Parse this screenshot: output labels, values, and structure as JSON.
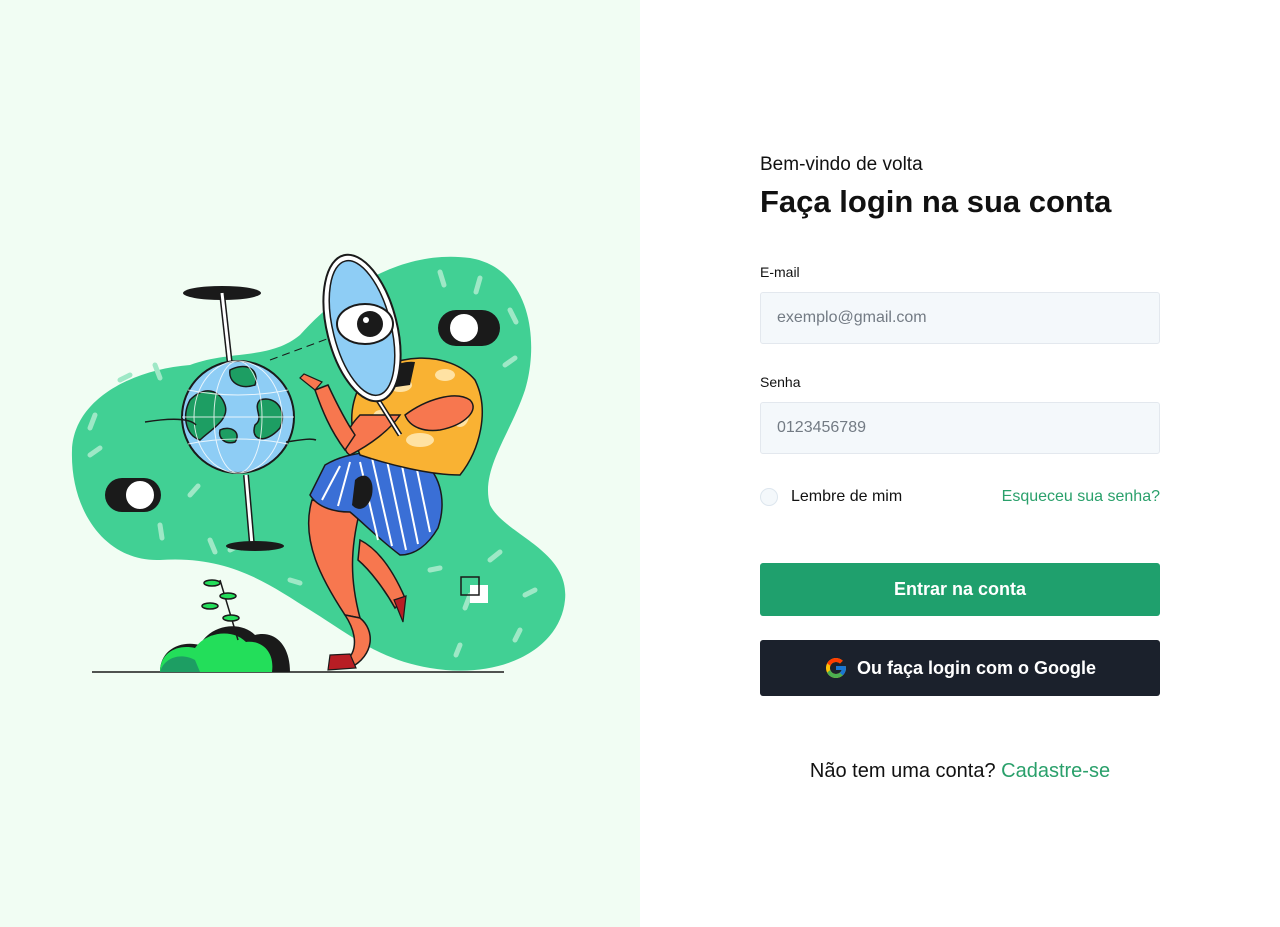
{
  "illustration": {
    "icon": "person-with-magnifier-and-globe-illustration",
    "colors": {
      "panel_bg": "#f1fdf3",
      "blob": "#41d094",
      "shirt": "#f9b233",
      "skin": "#f7774f",
      "shorts": "#3a6fd6"
    }
  },
  "form": {
    "welcome": "Bem-vindo de volta",
    "title": "Faça login na sua conta",
    "email": {
      "label": "E-mail",
      "placeholder": "exemplo@gmail.com",
      "value": ""
    },
    "password": {
      "label": "Senha",
      "placeholder": "0123456789",
      "value": ""
    },
    "remember_label": "Lembre de mim",
    "forgot_link": "Esqueceu sua senha?",
    "login_button": "Entrar na conta",
    "google_button": "Ou faça login com o Google",
    "google_icon": "google-icon",
    "signup_prompt": "Não tem uma conta?",
    "signup_link": "Cadastre-se"
  },
  "colors": {
    "accent": "#1fa06d",
    "link": "#2aa06b",
    "dark_button": "#1b212c",
    "input_bg": "#f4f8fb"
  }
}
